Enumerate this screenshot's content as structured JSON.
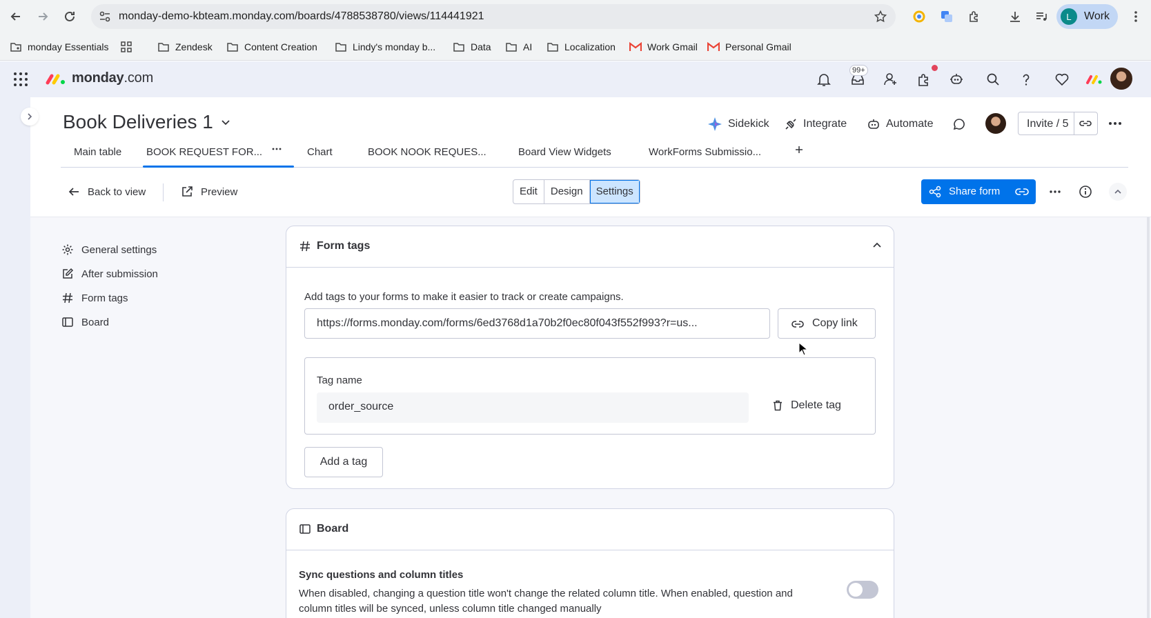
{
  "browser": {
    "url": "monday-demo-kbteam.monday.com/boards/4788538780/views/114441921",
    "profile_initial": "L",
    "profile_label": "Work",
    "bookmarks": [
      {
        "label": "monday Essentials",
        "icon": "folder-shared-icon"
      },
      {
        "label": "Zendesk",
        "icon": "folder-icon"
      },
      {
        "label": "Content Creation",
        "icon": "folder-icon"
      },
      {
        "label": "Lindy's monday b...",
        "icon": "folder-icon"
      },
      {
        "label": "Data",
        "icon": "folder-icon"
      },
      {
        "label": "AI",
        "icon": "folder-icon"
      },
      {
        "label": "Localization",
        "icon": "folder-icon"
      },
      {
        "label": "Work Gmail",
        "icon": "gmail-icon"
      },
      {
        "label": "Personal Gmail",
        "icon": "gmail-icon"
      }
    ]
  },
  "header": {
    "brand_name": "monday",
    "brand_tld": ".com",
    "inbox_badge": "99+",
    "colors": {
      "accent": "#0073ea",
      "notification": "#e2445c"
    }
  },
  "board": {
    "title": "Book Deliveries 1",
    "actions": {
      "sidekick": "Sidekick",
      "integrate": "Integrate",
      "automate": "Automate",
      "invite": "Invite / 5"
    },
    "tabs": [
      {
        "label": "Main table"
      },
      {
        "label": "BOOK REQUEST FOR..."
      },
      {
        "label": "Chart"
      },
      {
        "label": "BOOK NOOK REQUES..."
      },
      {
        "label": "Board View Widgets"
      },
      {
        "label": "WorkForms Submissio..."
      }
    ]
  },
  "toolbar": {
    "back": "Back to view",
    "preview": "Preview",
    "modes": [
      "Edit",
      "Design",
      "Settings"
    ],
    "active_mode": "Settings",
    "share": "Share form"
  },
  "side_nav": [
    {
      "label": "General settings",
      "icon": "gear-icon"
    },
    {
      "label": "After submission",
      "icon": "edit-icon"
    },
    {
      "label": "Form tags",
      "icon": "hash-icon"
    },
    {
      "label": "Board",
      "icon": "board-icon"
    }
  ],
  "form_tags": {
    "title": "Form tags",
    "description": "Add tags to your forms to make it easier to track or create campaigns.",
    "url": "https://forms.monday.com/forms/6ed3768d1a70b2f0ec80f043f552f993?r=us...",
    "copy_link": "Copy link",
    "tag_label": "Tag name",
    "tag_value": "order_source",
    "delete_tag": "Delete tag",
    "add_tag": "Add a tag"
  },
  "board_section": {
    "title": "Board",
    "sync_title": "Sync questions and column titles",
    "sync_desc": "When disabled, changing a question title won't change the related column title. When enabled, question and column titles will be synced, unless column title changed manually",
    "sync_enabled": false
  }
}
